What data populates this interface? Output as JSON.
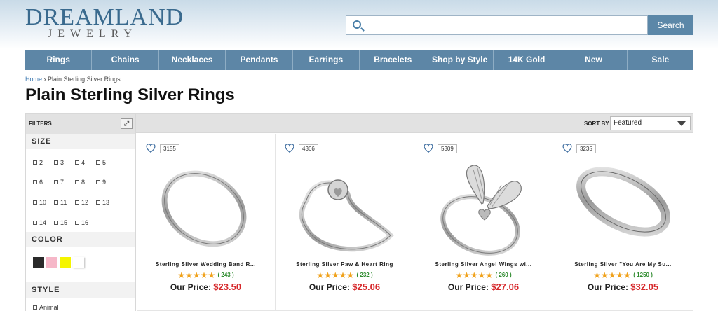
{
  "brand": {
    "logo_top": "DREAMLAND",
    "logo_bottom": "JEWELRY"
  },
  "search": {
    "placeholder": "",
    "button_label": "Search"
  },
  "nav": {
    "items": [
      "Rings",
      "Chains",
      "Necklaces",
      "Pendants",
      "Earrings",
      "Bracelets",
      "Shop by Style",
      "14K Gold",
      "New",
      "Sale"
    ]
  },
  "breadcrumb": {
    "home": "Home",
    "sep": "›",
    "current": "Plain Sterling Silver Rings"
  },
  "page_title": "Plain Sterling Silver Rings",
  "filters": {
    "header": "FILTERS",
    "size_title": "SIZE",
    "sizes": [
      "2",
      "3",
      "4",
      "5",
      "6",
      "7",
      "8",
      "9",
      "10",
      "11",
      "12",
      "13",
      "14",
      "15",
      "16"
    ],
    "color_title": "COLOR",
    "colors": [
      "#2a2a2a",
      "#f6b7c8",
      "#f5f500",
      "#ffffff"
    ],
    "style_title": "STYLE",
    "styles": [
      "Animal"
    ]
  },
  "sort": {
    "label": "SORT BY",
    "value": "Featured"
  },
  "products": [
    {
      "likes": "3155",
      "name": "Sterling Silver Wedding Band R...",
      "stars": "★★★★★",
      "reviews": "( 243 )",
      "price_label": "Our Price:",
      "price": "$23.50"
    },
    {
      "likes": "4366",
      "name": "Sterling Silver Paw & Heart Ring",
      "stars": "★★★★★",
      "reviews": "( 232 )",
      "price_label": "Our Price:",
      "price": "$25.06"
    },
    {
      "likes": "5309",
      "name": "Sterling Silver Angel Wings wi...",
      "stars": "★★★★★",
      "reviews": "( 260 )",
      "price_label": "Our Price:",
      "price": "$27.06"
    },
    {
      "likes": "3235",
      "name": "Sterling Silver \"You Are My Su...",
      "stars": "★★★★★",
      "reviews": "( 1250 )",
      "price_label": "Our Price:",
      "price": "$32.05"
    }
  ],
  "colors": {
    "nav": "#5d86a6",
    "price": "#d6282b",
    "star": "#f0a21c",
    "review_count": "#2d8a2d"
  }
}
